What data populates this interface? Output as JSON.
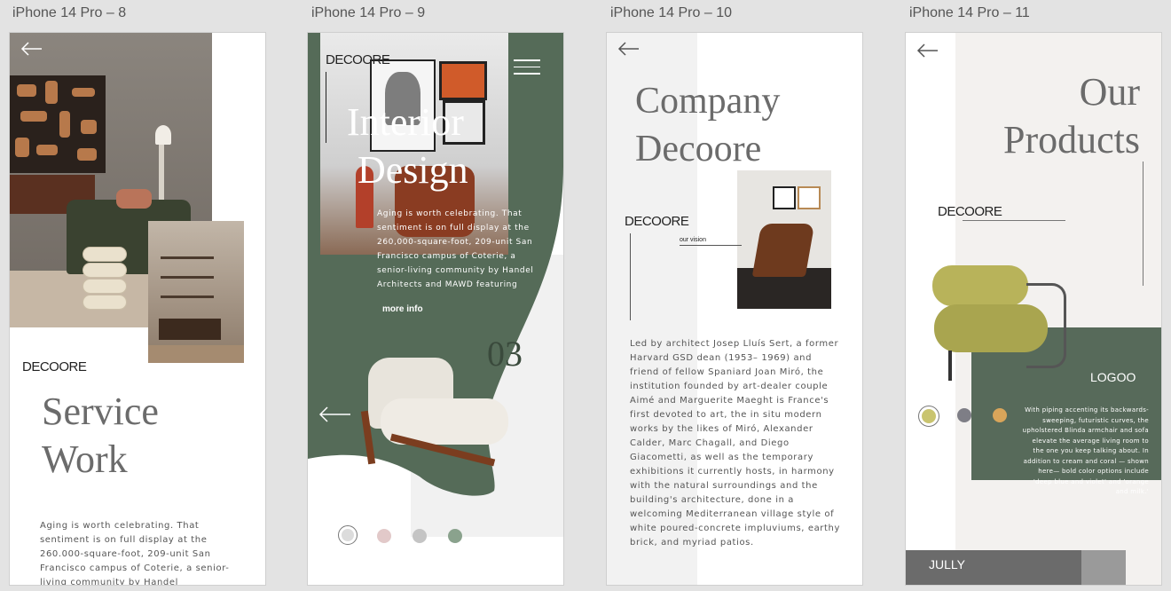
{
  "frames": [
    {
      "label": "iPhone 14 Pro – 8"
    },
    {
      "label": "iPhone 14 Pro – 9"
    },
    {
      "label": "iPhone 14 Pro – 10"
    },
    {
      "label": "iPhone 14 Pro – 11"
    }
  ],
  "service": {
    "brand": "DECOORE",
    "title_line1": "Service",
    "title_line2": "Work",
    "body": "Aging is worth celebrating. That sentiment is on full display at the 260.000-square-foot, 209-unit San Francisco campus of Coterie, a senior-living community by Handel"
  },
  "interior": {
    "brand": "DECOORE",
    "title_line1": "Interior",
    "title_line2": "Design",
    "body": "Aging is worth celebrating. That sentiment is on full display at the 260,000-square-foot, 209-unit San Francisco campus of Coterie, a senior-living community by Handel Architects and MAWD featuring",
    "more_info": "more info",
    "number": "03",
    "swatches": [
      "#dcdcdc",
      "#e2c9c9",
      "#c4c4c4",
      "#8aa28d"
    ]
  },
  "company": {
    "title_line1": "Company",
    "title_line2": "Decoore",
    "brand": "DECOORE",
    "our_vision": "our vision",
    "body": "Led by architect Josep Lluís Sert, a former Harvard GSD dean (1953– 1969) and friend of fellow Spaniard Joan Miró, the institution founded by art-dealer couple Aimé and Marguerite Maeght is France's first devoted to art, the in situ modern works by the likes of Miró, Alexander Calder, Marc Chagall, and Diego Giacometti, as well as the temporary exhibitions it currently hosts, in harmony with the natural surroundings and the building's architecture, done in a welcoming Mediterranean village style of white poured-concrete impluviums, earthy brick, and myriad patios."
  },
  "products": {
    "title_line1": "Our",
    "title_line2": "Products",
    "brand": "DECOORE",
    "logo": "LOGOO",
    "body": "With piping accenting its backwards-sweeping, futuristic curves, the upholstered Blinda armchair and sofa elevate the average living room to the one you keep talking about. In addition to cream and coral — shown here— bold color options include 'deep blue and violet' and 'orange and milk.'",
    "footer": "JULLY",
    "swatches": [
      "#c9c46f",
      "#7e7e86",
      "#d9a55a"
    ]
  },
  "colors": {
    "green": "#556b58",
    "gray_text": "#6b6b6b",
    "canvas": "#e3e3e3"
  }
}
